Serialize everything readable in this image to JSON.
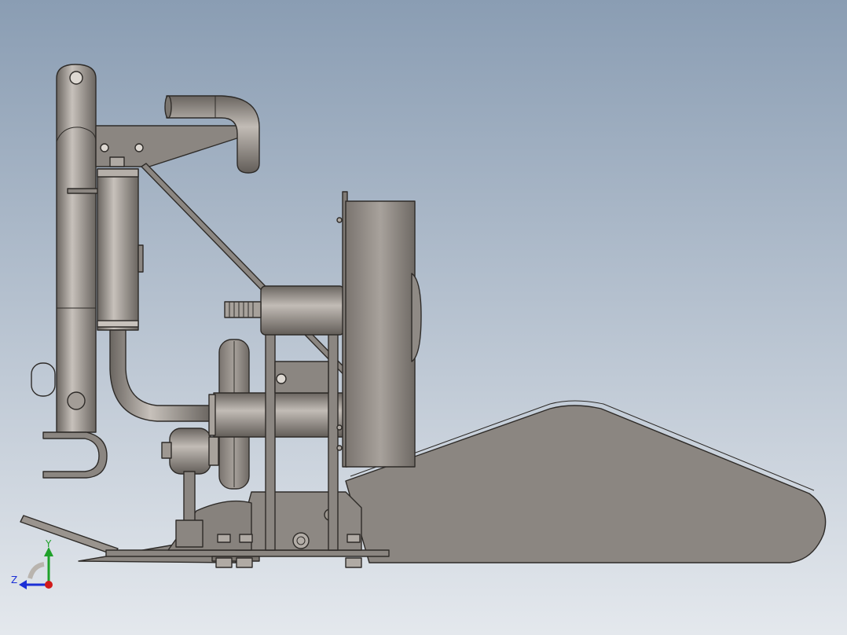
{
  "viewport": {
    "background_top": "#8a9db3",
    "background_bottom": "#e4e8ed",
    "part_fill": "#8b8681",
    "part_light": "#c4beb8",
    "part_dark": "#5e5955",
    "edge": "#2e2b28"
  },
  "triad": {
    "y_label": "Y",
    "z_label": "Z",
    "y_color": "#1fa12a",
    "z_color": "#1b2fd6",
    "x_color": "#d11a1a"
  }
}
